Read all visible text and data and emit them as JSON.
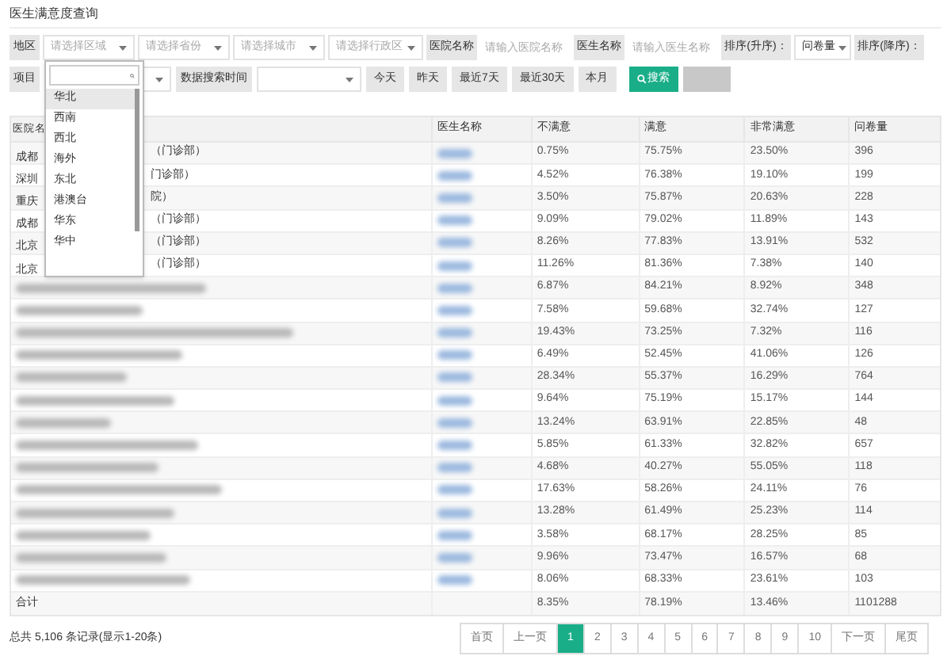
{
  "title": "医生满意度查询",
  "filters": [
    [
      {
        "kind": "label",
        "text": "地区"
      },
      {
        "kind": "select",
        "placeholder": "请选择区域"
      },
      {
        "kind": "select",
        "placeholder": "请选择省份"
      },
      {
        "kind": "select",
        "placeholder": "请选择城市"
      },
      {
        "kind": "select",
        "placeholder": "请选择行政区"
      },
      {
        "kind": "label",
        "text": "医院名称"
      },
      {
        "kind": "input",
        "placeholder": "请输入医院名称"
      },
      {
        "kind": "label",
        "text": "医生名称"
      },
      {
        "kind": "input",
        "placeholder": "请输入医生名称"
      },
      {
        "kind": "label",
        "text": "排序(升序)："
      },
      {
        "kind": "select",
        "value": "问卷量"
      },
      {
        "kind": "label",
        "text": "排序(降序)："
      }
    ],
    [
      {
        "kind": "label",
        "text": "项目"
      },
      {
        "kind": "select"
      },
      {
        "kind": "label",
        "text": "数据搜索时间"
      },
      {
        "kind": "select"
      },
      {
        "kind": "button",
        "label": "今天"
      },
      {
        "kind": "button",
        "label": "昨天"
      },
      {
        "kind": "button",
        "label": "最近7天"
      },
      {
        "kind": "button",
        "label": "最近30天"
      },
      {
        "kind": "button",
        "label": "本月"
      },
      {
        "kind": "search",
        "label": "搜索"
      },
      {
        "kind": "disabled"
      }
    ]
  ],
  "dropdown": {
    "options": [
      {
        "label": "华北",
        "selected": true
      },
      {
        "label": "西南",
        "selected": false
      },
      {
        "label": "西北",
        "selected": false
      },
      {
        "label": "海外",
        "selected": false
      },
      {
        "label": "东北",
        "selected": false
      },
      {
        "label": "港澳台",
        "selected": false
      },
      {
        "label": "华东",
        "selected": false
      },
      {
        "label": "华中",
        "selected": false
      }
    ]
  },
  "table": {
    "columns": [
      "医院名",
      "医生名称",
      "不满意",
      "满意",
      "非常满意",
      "问卷量"
    ],
    "rows": [
      {
        "hospital_prefix": "成都",
        "hospital_suffix": "（门诊部）",
        "values": [
          "0.75%",
          "75.75%",
          "23.50%",
          "396"
        ]
      },
      {
        "hospital_prefix": "深圳",
        "hospital_suffix": "门诊部）",
        "values": [
          "4.52%",
          "76.38%",
          "19.10%",
          "199"
        ]
      },
      {
        "hospital_prefix": "重庆",
        "hospital_suffix": "院）",
        "values": [
          "3.50%",
          "75.87%",
          "20.63%",
          "228"
        ]
      },
      {
        "hospital_prefix": "成都",
        "hospital_suffix": "（门诊部）",
        "values": [
          "9.09%",
          "79.02%",
          "11.89%",
          "143"
        ]
      },
      {
        "hospital_prefix": "北京",
        "hospital_suffix": "（门诊部）",
        "values": [
          "8.26%",
          "77.83%",
          "13.91%",
          "532"
        ]
      },
      {
        "hospital_prefix": "北京",
        "hospital_suffix": "（门诊部）",
        "values": [
          "11.26%",
          "81.36%",
          "7.38%",
          "140"
        ]
      },
      {
        "values": [
          "6.87%",
          "84.21%",
          "8.92%",
          "348"
        ]
      },
      {
        "values": [
          "7.58%",
          "59.68%",
          "32.74%",
          "127"
        ]
      },
      {
        "values": [
          "19.43%",
          "73.25%",
          "7.32%",
          "116"
        ]
      },
      {
        "values": [
          "6.49%",
          "52.45%",
          "41.06%",
          "126"
        ]
      },
      {
        "values": [
          "28.34%",
          "55.37%",
          "16.29%",
          "764"
        ]
      },
      {
        "values": [
          "9.64%",
          "75.19%",
          "15.17%",
          "144"
        ]
      },
      {
        "values": [
          "13.24%",
          "63.91%",
          "22.85%",
          "48"
        ]
      },
      {
        "values": [
          "5.85%",
          "61.33%",
          "32.82%",
          "657"
        ]
      },
      {
        "values": [
          "4.68%",
          "40.27%",
          "55.05%",
          "118"
        ]
      },
      {
        "values": [
          "17.63%",
          "58.26%",
          "24.11%",
          "76"
        ]
      },
      {
        "values": [
          "13.28%",
          "61.49%",
          "25.23%",
          "114"
        ]
      },
      {
        "values": [
          "3.58%",
          "68.17%",
          "28.25%",
          "85"
        ]
      },
      {
        "values": [
          "9.96%",
          "73.47%",
          "16.57%",
          "68"
        ]
      },
      {
        "values": [
          "8.06%",
          "68.33%",
          "23.61%",
          "103"
        ]
      }
    ],
    "total": {
      "label": "合计",
      "values": [
        "8.35%",
        "78.19%",
        "13.46%",
        "1101288"
      ]
    }
  },
  "footer": {
    "summary": "总共 5,106 条记录(显示1-20条)",
    "pagination": [
      {
        "label": "首页",
        "selected": false
      },
      {
        "label": "上一页",
        "selected": false
      },
      {
        "label": "1",
        "selected": true
      },
      {
        "label": "2",
        "selected": false
      },
      {
        "label": "3",
        "selected": false
      },
      {
        "label": "4",
        "selected": false
      },
      {
        "label": "5",
        "selected": false
      },
      {
        "label": "6",
        "selected": false
      },
      {
        "label": "7",
        "selected": false
      },
      {
        "label": "8",
        "selected": false
      },
      {
        "label": "9",
        "selected": false
      },
      {
        "label": "10",
        "selected": false
      },
      {
        "label": "下一页",
        "selected": false
      },
      {
        "label": "尾页",
        "selected": false
      }
    ]
  }
}
